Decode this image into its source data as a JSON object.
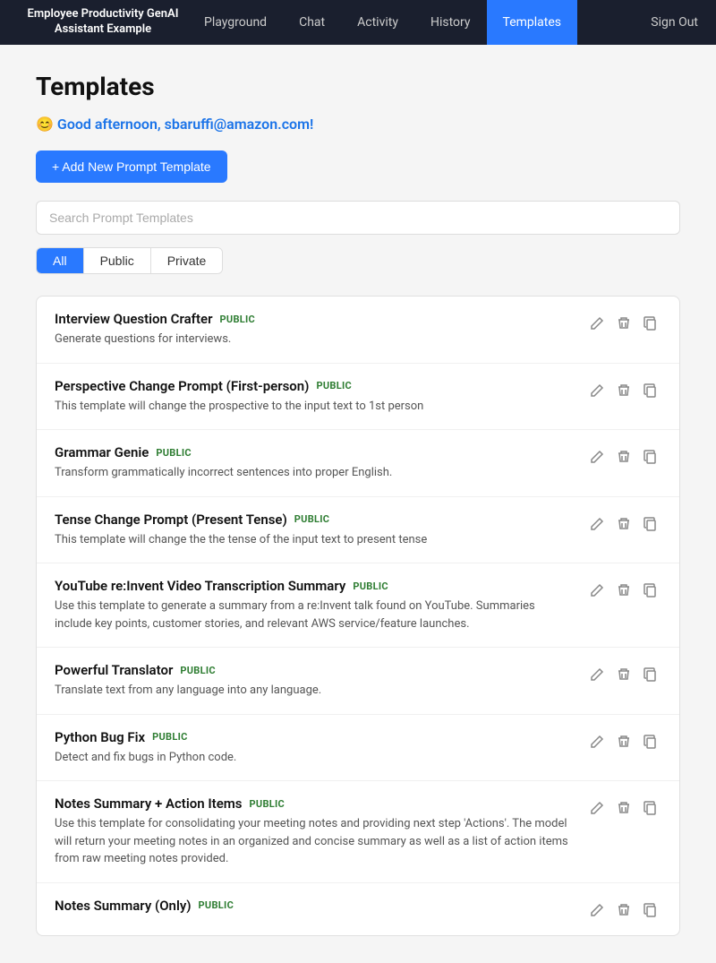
{
  "app": {
    "brand": "Employee Productivity GenAI\nAssistant Example",
    "sign_out_label": "Sign Out"
  },
  "nav": {
    "links": [
      {
        "id": "playground",
        "label": "Playground",
        "active": false
      },
      {
        "id": "chat",
        "label": "Chat",
        "active": false
      },
      {
        "id": "activity",
        "label": "Activity",
        "active": false
      },
      {
        "id": "history",
        "label": "History",
        "active": false
      },
      {
        "id": "templates",
        "label": "Templates",
        "active": true
      }
    ]
  },
  "page": {
    "title": "Templates",
    "greeting_emoji": "😊",
    "greeting_text": "Good afternoon, sbaruffi@amazon.com!",
    "add_button_label": "+ Add New Prompt Template",
    "search_placeholder": "Search Prompt Templates",
    "filter_tabs": [
      "All",
      "Public",
      "Private"
    ],
    "active_filter": "All"
  },
  "templates": [
    {
      "name": "Interview Question Crafter",
      "badge": "PUBLIC",
      "description": "Generate questions for interviews."
    },
    {
      "name": "Perspective Change Prompt (First-person)",
      "badge": "PUBLIC",
      "description": "This template will change the prospective to the input text to 1st person"
    },
    {
      "name": "Grammar Genie",
      "badge": "PUBLIC",
      "description": "Transform grammatically incorrect sentences into proper English."
    },
    {
      "name": "Tense Change Prompt (Present Tense)",
      "badge": "PUBLIC",
      "description": "This template will change the the tense of the input text to present tense"
    },
    {
      "name": "YouTube re:Invent Video Transcription Summary",
      "badge": "PUBLIC",
      "description": "Use this template to generate a summary from a re:Invent talk found on YouTube. Summaries include key points, customer stories, and relevant AWS service/feature launches."
    },
    {
      "name": "Powerful Translator",
      "badge": "PUBLIC",
      "description": "Translate text from any language into any language."
    },
    {
      "name": "Python Bug Fix",
      "badge": "PUBLIC",
      "description": "Detect and fix bugs in Python code."
    },
    {
      "name": "Notes Summary + Action Items",
      "badge": "PUBLIC",
      "description": "Use this template for consolidating your meeting notes and providing next step 'Actions'. The model will return your meeting notes in an organized and concise summary as well as a list of action items from raw meeting notes provided."
    },
    {
      "name": "Notes Summary (Only)",
      "badge": "PUBLIC",
      "description": ""
    }
  ]
}
